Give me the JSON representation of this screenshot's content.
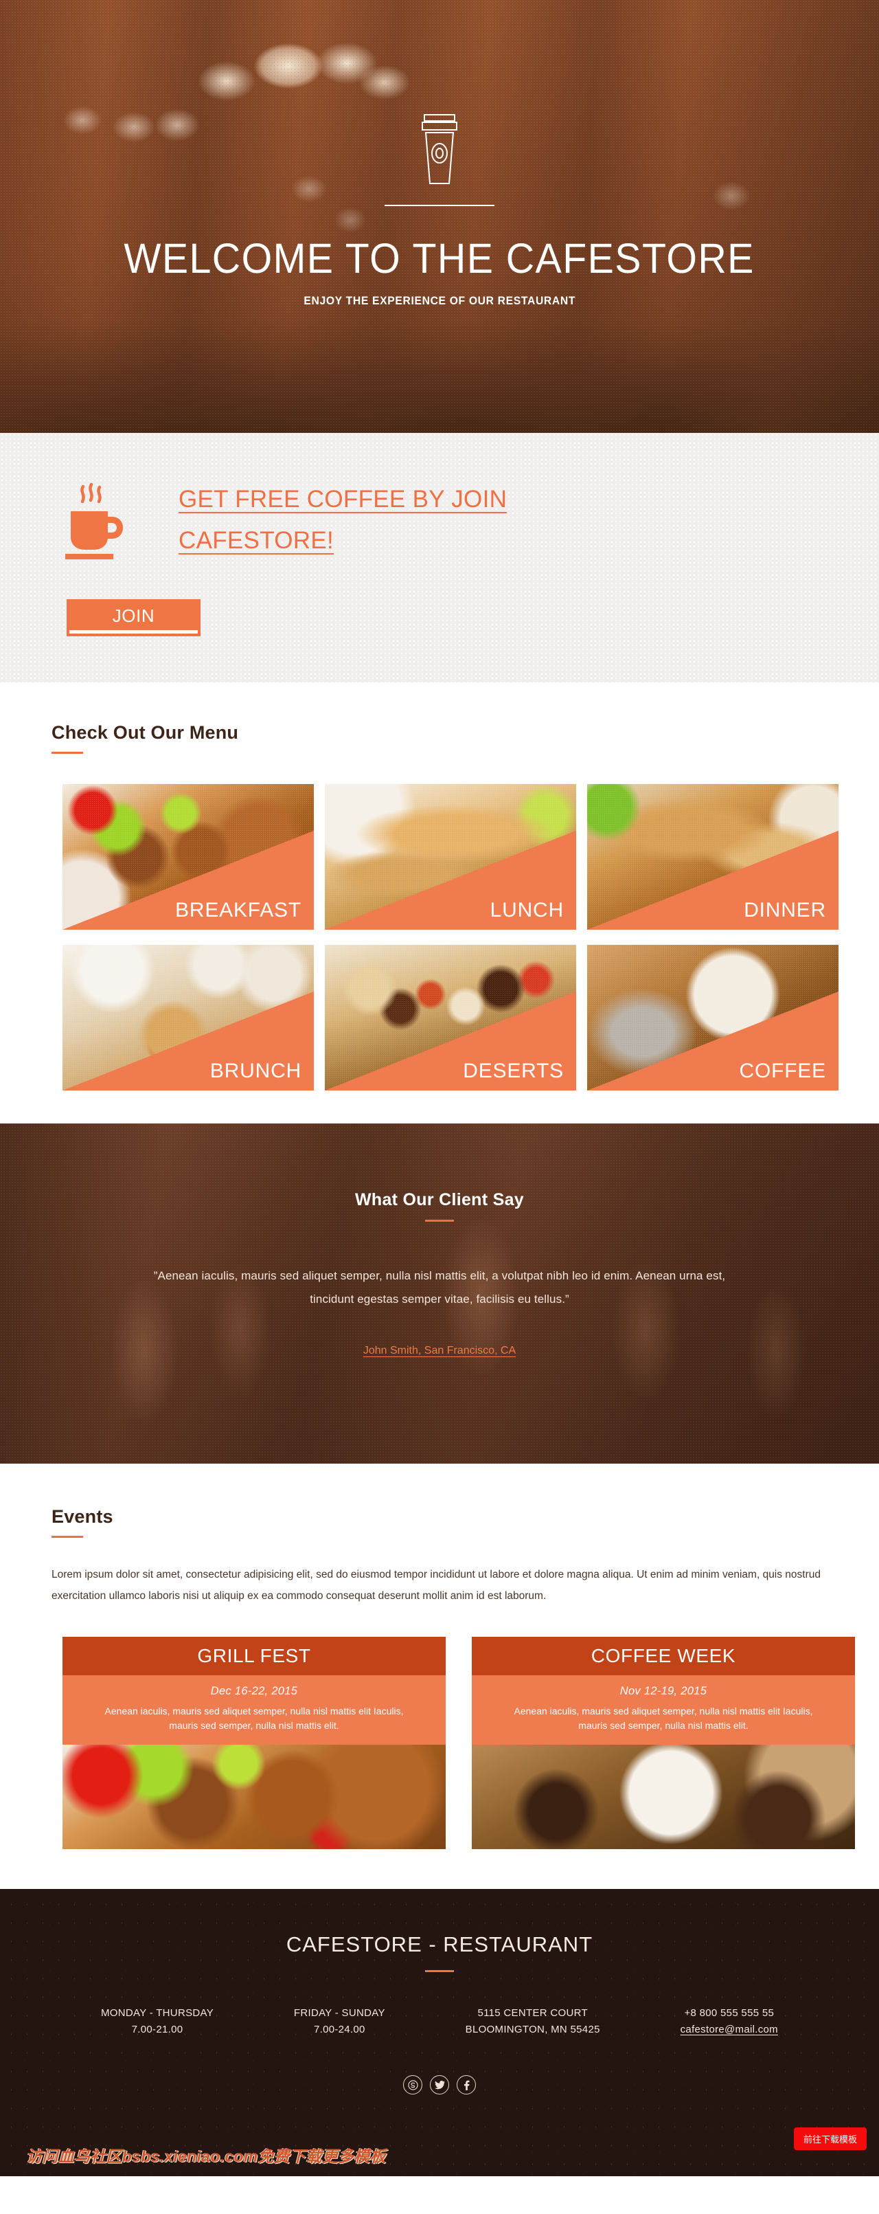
{
  "hero": {
    "icon": "coffee-cup-to-go-icon",
    "title": "WELCOME TO THE CAFESTORE",
    "subtitle": "ENJOY THE EXPERIENCE OF OUR RESTAURANT"
  },
  "cta": {
    "icon": "steaming-coffee-mug-icon",
    "headline": "GET FREE COFFEE BY JOIN CAFESTORE!",
    "button_label": "JOIN",
    "accent_color": "#ef7544",
    "background_color": "#f1efee"
  },
  "menu": {
    "title": "Check Out Our Menu",
    "items": [
      {
        "label": "BREAKFAST",
        "photo": "grilled-sausages-salad-photo"
      },
      {
        "label": "LUNCH",
        "photo": "breaded-cutlet-fries-photo"
      },
      {
        "label": "DINNER",
        "photo": "roasted-chicken-photo"
      },
      {
        "label": "BRUNCH",
        "photo": "pancakes-coffee-table-photo"
      },
      {
        "label": "DESERTS",
        "photo": "assorted-pastries-platter-photo"
      },
      {
        "label": "COFFEE",
        "photo": "latte-art-cup-photo"
      }
    ]
  },
  "testimonial": {
    "title": "What Our Client Say",
    "quote": "”Aenean iaculis, mauris sed aliquet semper, nulla nisl mattis elit, a volutpat nibh leo id enim. Aenean urna est, tincidunt egestas semper vitae, facilisis eu tellus.”",
    "author": "John Smith, San Francisco, CA"
  },
  "events": {
    "title": "Events",
    "paragraph": "Lorem ipsum dolor sit amet, consectetur adipisicing elit, sed do eiusmod tempor incididunt ut labore et dolore magna aliqua. Ut enim ad minim veniam, quis nostrud exercitation ullamco laboris nisi ut aliquip ex ea commodo consequat deserunt mollit anim id est laborum.",
    "cards": [
      {
        "title": "GRILL FEST",
        "date": "Dec 16-22, 2015",
        "description": "Aenean iaculis, mauris sed aliquet semper, nulla nisl mattis elit Iaculis, mauris sed semper, nulla nisl mattis elit.",
        "photo": "grilled-meat-photo"
      },
      {
        "title": "COFFEE WEEK",
        "date": "Nov 12-19, 2015",
        "description": "Aenean iaculis, mauris sed aliquet semper, nulla nisl mattis elit Iaculis, mauris sed semper, nulla nisl mattis elit.",
        "photo": "coffee-cup-beans-photo"
      }
    ]
  },
  "footer": {
    "brand": "CAFESTORE - RESTAURANT",
    "columns": [
      {
        "line1": "MONDAY - THURSDAY",
        "line2": "7.00-21.00"
      },
      {
        "line1": "FRIDAY - SUNDAY",
        "line2": "7.00-24.00"
      },
      {
        "line1": "5115 CENTER COURT",
        "line2": "BLOOMINGTON, MN 55425"
      },
      {
        "line1": "+8 800 555 555 55",
        "line2": "cafestore@mail.com"
      }
    ],
    "socials": [
      "skype-icon",
      "twitter-icon",
      "facebook-icon"
    ],
    "background_color": "#241510"
  },
  "overlay": {
    "watermark": "访问血鸟社区bsbs.xieniao.com免费下载更多模板",
    "download_button": "前往下载模板"
  }
}
